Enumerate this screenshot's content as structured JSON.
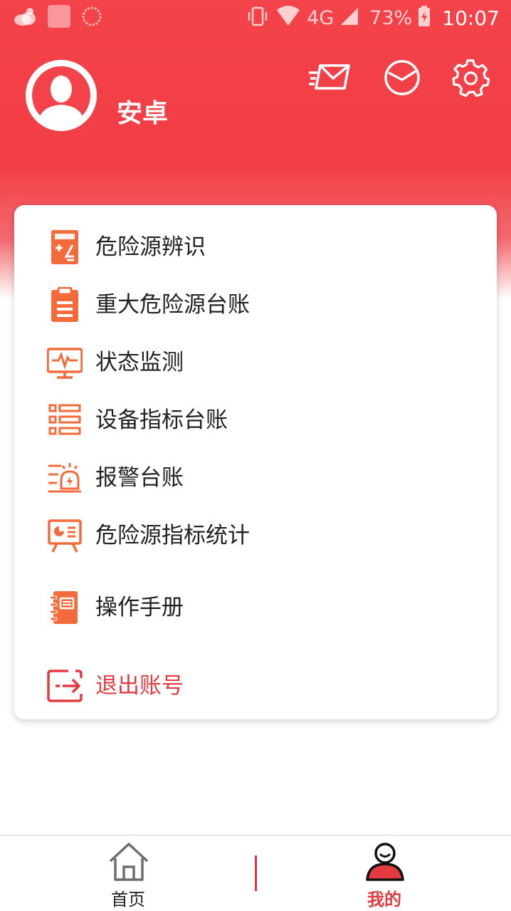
{
  "status_bar": {
    "network": "4G",
    "battery": "73%",
    "time": "10:07"
  },
  "profile": {
    "username": "安卓"
  },
  "header_icons": [
    "message-icon",
    "clock-icon",
    "settings-icon"
  ],
  "menu": {
    "items": [
      {
        "label": "危险源辨识",
        "icon": "calculator-icon"
      },
      {
        "label": "重大危险源台账",
        "icon": "clipboard-icon"
      },
      {
        "label": "状态监测",
        "icon": "monitor-pulse-icon"
      },
      {
        "label": "设备指标台账",
        "icon": "list-icon"
      },
      {
        "label": "报警台账",
        "icon": "alarm-light-icon"
      },
      {
        "label": "危险源指标统计",
        "icon": "presentation-chart-icon"
      },
      {
        "label": "操作手册",
        "icon": "notebook-icon"
      }
    ],
    "logout_label": "退出账号"
  },
  "bottom_nav": {
    "home_label": "首页",
    "mine_label": "我的",
    "active": "mine"
  },
  "colors": {
    "brand_red": "#f4434a",
    "icon_orange": "#f36b3a",
    "logout_red": "#e33b40"
  }
}
